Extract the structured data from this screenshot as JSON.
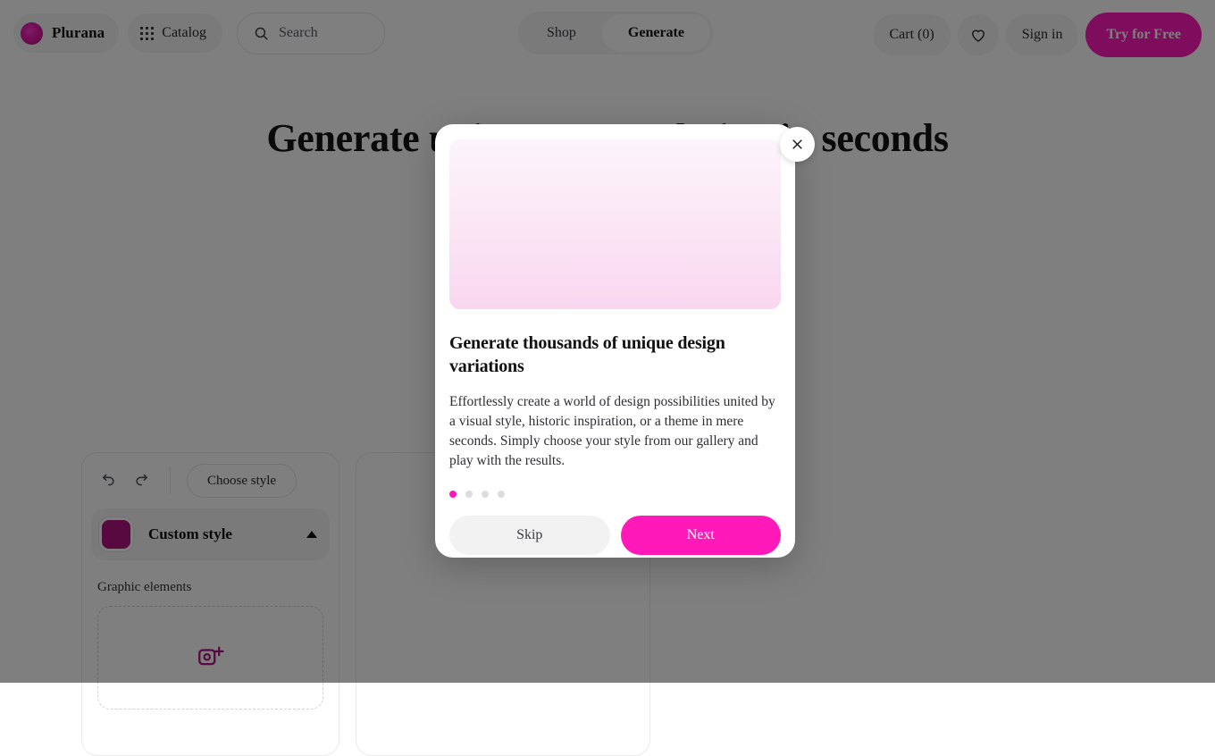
{
  "header": {
    "logo": {
      "icon": "plurana-logo-icon",
      "text": "Plurana"
    },
    "catalog": {
      "icon": "grid-icon",
      "label": "Catalog"
    },
    "search": {
      "icon": "search-icon",
      "placeholder": "Search",
      "value": ""
    },
    "segments": [
      {
        "label": "Shop",
        "active": false
      },
      {
        "label": "Generate",
        "active": true
      }
    ],
    "cart_label": "Cart (0)",
    "favorites_icon": "heart-icon",
    "signin_label": "Sign in",
    "cta_label": "Try for Free"
  },
  "hero": {
    "title": "Generate unique vector design in seconds"
  },
  "editor": {
    "undo_icon": "undo-icon",
    "redo_icon": "redo-icon",
    "choose_style_label": "Choose style",
    "style": {
      "name": "Custom style",
      "swatch_color": "#b0127f",
      "caret_icon": "chevron-up-icon"
    },
    "graphic_elements_label": "Graphic elements",
    "dropzone_icon": "add-image-icon"
  },
  "modal": {
    "close_icon": "close-icon",
    "media_alt": "pink-gradient-preview",
    "title": "Generate thousands of unique design variations",
    "body": "Effortlessly create a world of design possibilities united by a visual style, historic inspiration, or a theme in mere seconds. Simply choose your style from our gallery and play with the results.",
    "dots": [
      {
        "active": true
      },
      {
        "active": false
      },
      {
        "active": false
      },
      {
        "active": false
      }
    ],
    "skip_label": "Skip",
    "next_label": "Next"
  },
  "colors": {
    "accent": "#ff19b8",
    "accent_dark": "#b0127f",
    "text": "#111113",
    "surface": "#f4f4f5"
  }
}
